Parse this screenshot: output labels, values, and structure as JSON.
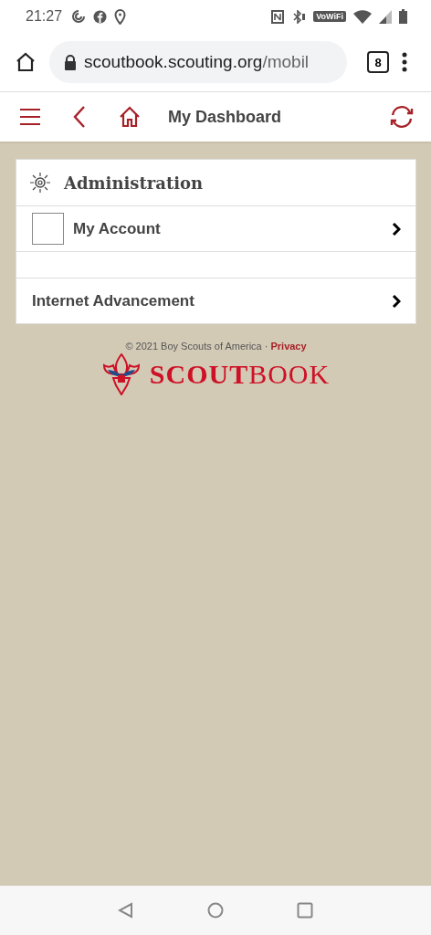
{
  "status_bar": {
    "time": "21:27",
    "wifi_label": "VoWiFi"
  },
  "browser": {
    "url_host": "scoutbook.scouting.org",
    "url_path": "/mobil",
    "tab_count": "8"
  },
  "header": {
    "title": "My Dashboard"
  },
  "card": {
    "heading": "Administration",
    "items": [
      {
        "kind": "account",
        "label": "My Account"
      },
      {
        "kind": "spacer"
      },
      {
        "kind": "link",
        "label": "Internet Advancement"
      }
    ]
  },
  "footer": {
    "copyright": "© 2021 Boy Scouts of America ·",
    "link": "Privacy",
    "logo_text": "**SCOUT**BOOK"
  }
}
